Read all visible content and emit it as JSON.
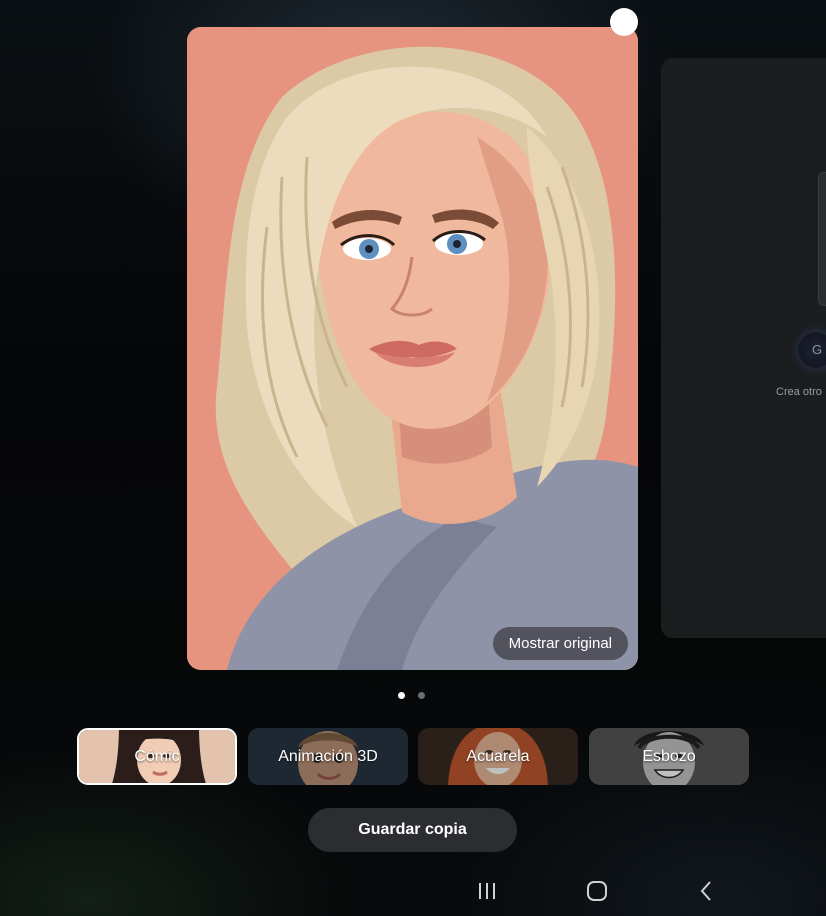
{
  "portrait": {
    "show_original_label": "Mostrar original"
  },
  "next_card": {
    "icon_letter": "G",
    "create_text": "Crea otro"
  },
  "pager": {
    "current_page": 1,
    "total_pages": 2
  },
  "styles": [
    {
      "label": "Cómic",
      "selected": true
    },
    {
      "label": "Animación 3D",
      "selected": false
    },
    {
      "label": "Acuarela",
      "selected": false
    },
    {
      "label": "Esbozo",
      "selected": false
    }
  ],
  "actions": {
    "save_copy_label": "Guardar copia"
  },
  "nav_bar": {
    "recents_icon": "recents-icon",
    "home_icon": "home-icon",
    "back_icon": "back-icon"
  },
  "colors": {
    "portrait_background": "#e6937f",
    "selected_border": "#ffffff",
    "button_background": "#2b2d30"
  }
}
